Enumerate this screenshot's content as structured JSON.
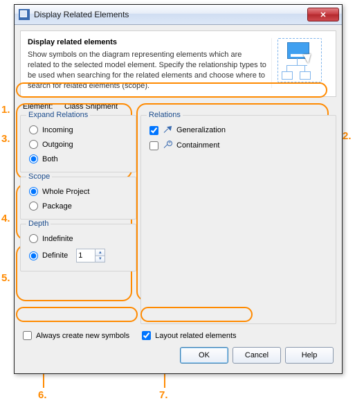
{
  "window": {
    "title": "Display Related Elements"
  },
  "header": {
    "title": "Display related elements",
    "description": "Show symbols on the diagram representing elements which are related to the selected model element. Specify the relationship types to be used when searching for the related elements and choose where to search for related elements (scope)."
  },
  "element": {
    "label": "Element:",
    "value": "Class Shipment"
  },
  "expandRelations": {
    "title": "Expand Relations",
    "options": {
      "incoming": "Incoming",
      "outgoing": "Outgoing",
      "both": "Both"
    },
    "selected": "both"
  },
  "scope": {
    "title": "Scope",
    "options": {
      "wholeProject": "Whole Project",
      "package": "Package"
    },
    "selected": "wholeProject"
  },
  "depth": {
    "title": "Depth",
    "options": {
      "indefinite": "Indefinite",
      "definite": "Definite"
    },
    "selected": "definite",
    "value": "1"
  },
  "relations": {
    "title": "Relations",
    "items": [
      {
        "label": "Generalization",
        "checked": true,
        "icon": "gen"
      },
      {
        "label": "Containment",
        "checked": false,
        "icon": "cont"
      }
    ]
  },
  "bottom": {
    "alwaysCreate": {
      "label": "Always create new symbols",
      "checked": false
    },
    "layoutRelated": {
      "label": "Layout related elements",
      "checked": true
    }
  },
  "buttons": {
    "ok": "OK",
    "cancel": "Cancel",
    "help": "Help"
  },
  "callouts": {
    "n1": "1.",
    "n2": "2.",
    "n3": "3.",
    "n4": "4.",
    "n5": "5.",
    "n6": "6.",
    "n7": "7."
  }
}
